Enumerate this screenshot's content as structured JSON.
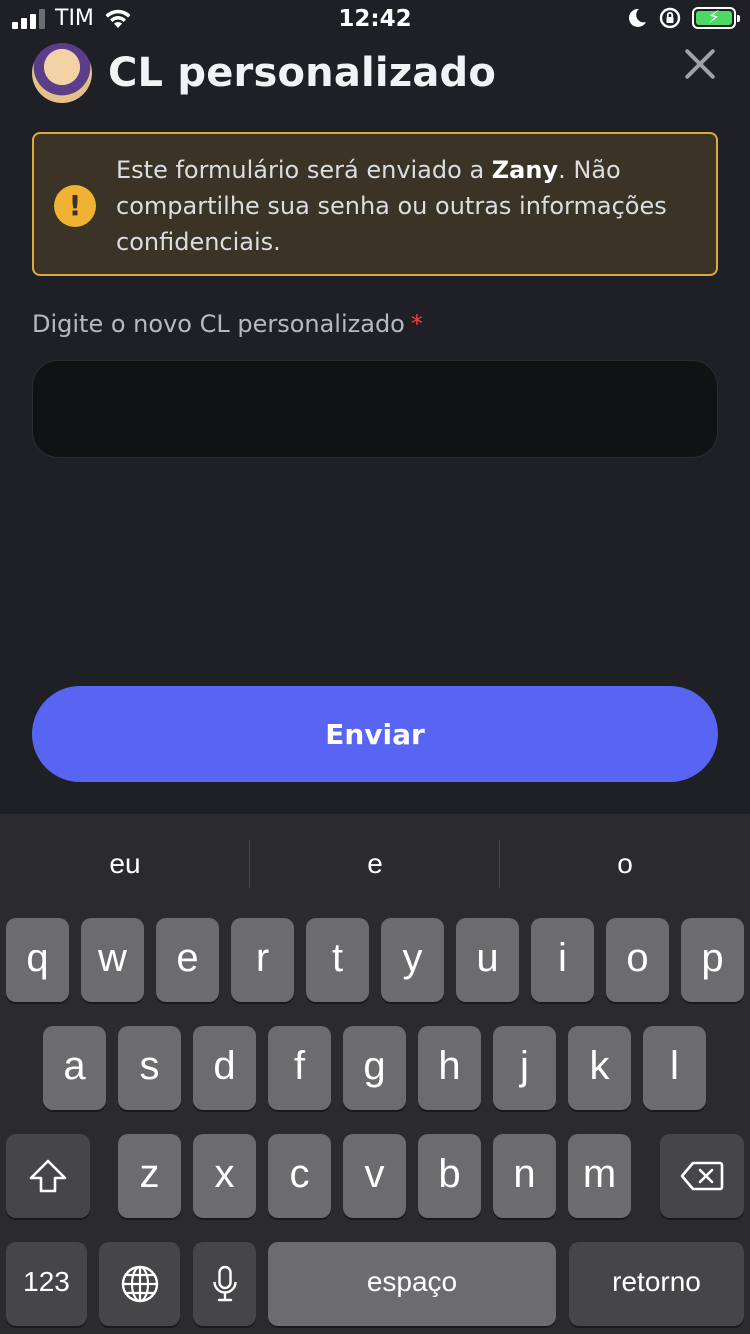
{
  "status_bar": {
    "carrier": "TIM",
    "time": "12:42"
  },
  "header": {
    "title": "CL personalizado"
  },
  "warning": {
    "text_before": "Este formulário será enviado a ",
    "recipient": "Zany",
    "text_after": ". Não compartilhe sua senha ou outras informações confidenciais."
  },
  "form": {
    "field_label": "Digite o novo CL personalizado",
    "required_marker": "*",
    "field_value": "",
    "submit_label": "Enviar"
  },
  "keyboard": {
    "suggestions": [
      "eu",
      "e",
      "o"
    ],
    "row1": [
      "q",
      "w",
      "e",
      "r",
      "t",
      "y",
      "u",
      "i",
      "o",
      "p"
    ],
    "row2": [
      "a",
      "s",
      "d",
      "f",
      "g",
      "h",
      "j",
      "k",
      "l"
    ],
    "row3": [
      "z",
      "x",
      "c",
      "v",
      "b",
      "n",
      "m"
    ],
    "numbers_label": "123",
    "space_label": "espaço",
    "return_label": "retorno"
  },
  "colors": {
    "background": "#1f2025",
    "accent": "#5865f2",
    "warning_border": "#e2a73a",
    "warning_icon": "#f0b232",
    "required": "#f23f43"
  }
}
